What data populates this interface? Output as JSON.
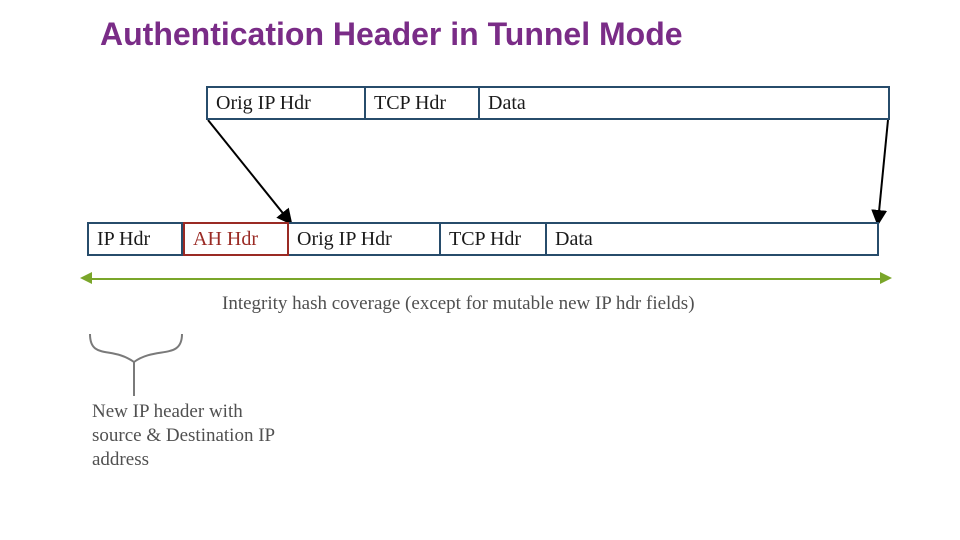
{
  "title": "Authentication Header in Tunnel Mode",
  "original_packet": {
    "ip": "Orig IP Hdr",
    "tcp": "TCP Hdr",
    "data": "Data"
  },
  "encapsulated_packet": {
    "new_ip": "IP Hdr",
    "ah": "AH Hdr",
    "orig_ip": "Orig IP Hdr",
    "tcp": "TCP Hdr",
    "data": "Data"
  },
  "annotations": {
    "integrity": "Integrity hash coverage (except for mutable new IP hdr fields)",
    "new_ip_header": "New IP header with source & Destination IP address"
  },
  "colors": {
    "title": "#7a2c87",
    "cell_border": "#274c6b",
    "ah_border": "#9a2a24",
    "integrity_line": "#7aa62a",
    "annotation_text": "#505050",
    "mapping_line": "#000000"
  }
}
